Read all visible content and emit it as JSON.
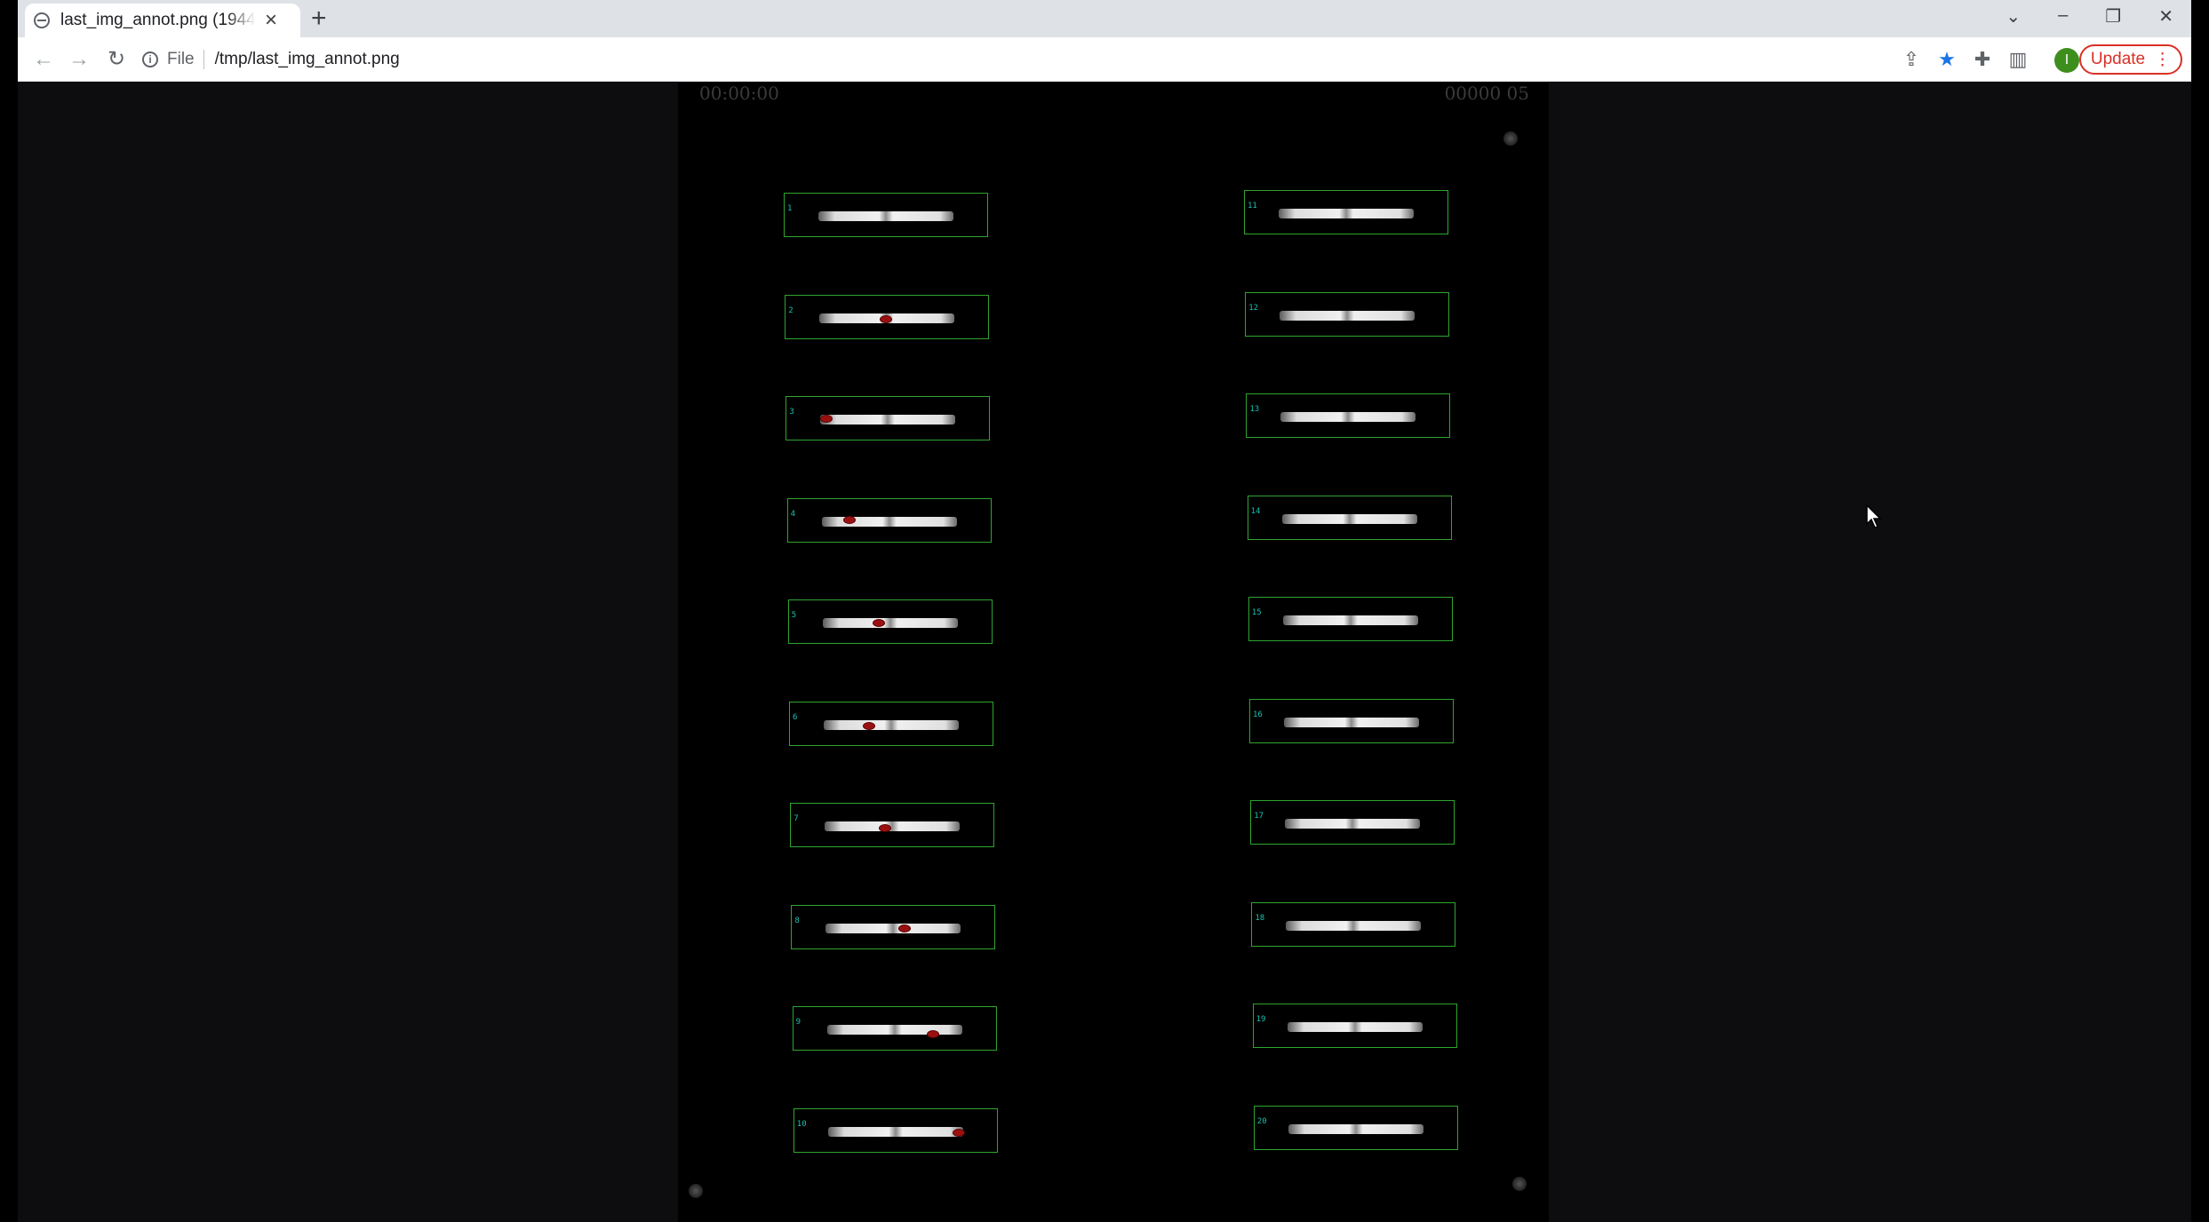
{
  "browser": {
    "tab_title": "last_img_annot.png (1944×",
    "tab_close": "×",
    "new_tab": "+",
    "scheme_label": "File",
    "url": "/tmp/last_img_annot.png",
    "update_label": "Update",
    "profile_initial": "I",
    "icons": [
      "back-arrow-icon",
      "forward-arrow-icon",
      "reload-icon",
      "info-icon",
      "share-icon",
      "star-icon",
      "extensions-icon",
      "side-panel-icon",
      "kebab-menu-icon"
    ]
  },
  "image": {
    "timestamp_left": "00:00:00",
    "timestamp_right": "00000 05",
    "wells_left": [
      "1",
      "2",
      "3",
      "4",
      "5",
      "6",
      "7",
      "8",
      "9",
      "10"
    ],
    "wells_right": [
      "11",
      "12",
      "13",
      "14",
      "15",
      "16",
      "17",
      "18",
      "19",
      "20"
    ]
  },
  "colors": {
    "box": "#2fa52f",
    "label": "#18c0b0",
    "blob": "#9a1010"
  }
}
